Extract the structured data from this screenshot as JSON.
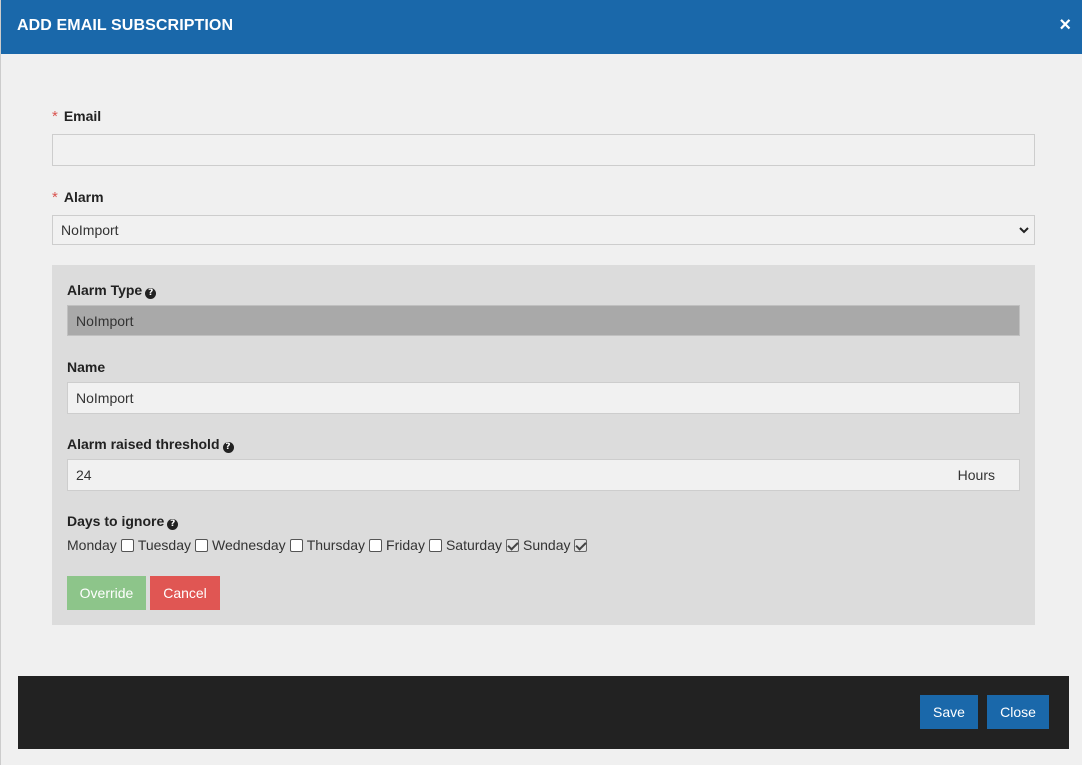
{
  "header": {
    "title": "ADD EMAIL SUBSCRIPTION",
    "close_glyph": "×"
  },
  "form": {
    "required_marker": "*",
    "email": {
      "label": "Email",
      "value": ""
    },
    "alarm": {
      "label": "Alarm",
      "selected": "NoImport"
    }
  },
  "panel": {
    "alarm_type": {
      "label": "Alarm Type",
      "value": "NoImport"
    },
    "name": {
      "label": "Name",
      "value": "NoImport"
    },
    "threshold": {
      "label": "Alarm raised threshold",
      "value": "24",
      "unit": "Hours"
    },
    "days": {
      "label": "Days to ignore",
      "items": [
        {
          "label": "Monday",
          "checked": false
        },
        {
          "label": "Tuesday",
          "checked": false
        },
        {
          "label": "Wednesday",
          "checked": false
        },
        {
          "label": "Thursday",
          "checked": false
        },
        {
          "label": "Friday",
          "checked": false
        },
        {
          "label": "Saturday",
          "checked": true
        },
        {
          "label": "Sunday",
          "checked": true
        }
      ]
    },
    "override_label": "Override",
    "cancel_label": "Cancel",
    "help_glyph": "?"
  },
  "footer": {
    "save_label": "Save",
    "close_label": "Close"
  },
  "colors": {
    "header": "#1a68aa",
    "override": "#8dc58a",
    "cancel": "#e05653",
    "footer": "#222222",
    "required": "#d9534f"
  }
}
